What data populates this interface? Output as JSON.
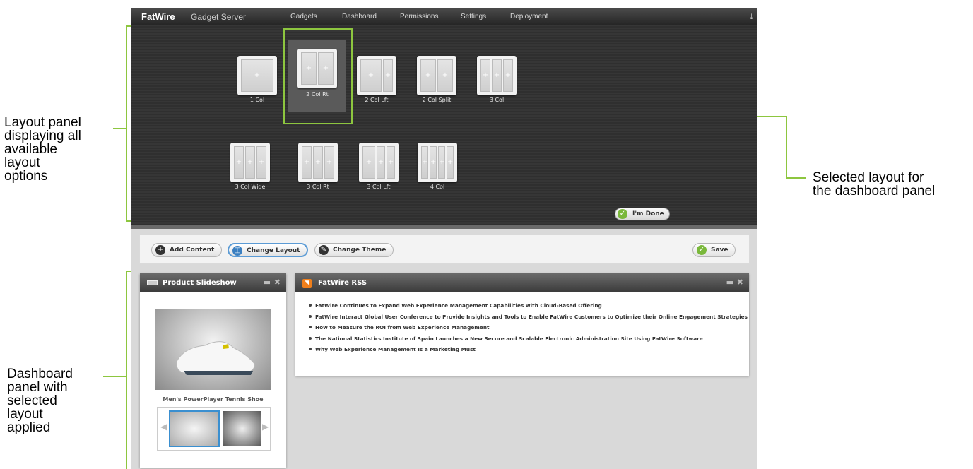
{
  "annotations": {
    "layout_panel": [
      "Layout panel",
      "displaying all",
      "available",
      "layout",
      "options"
    ],
    "selected_layout": [
      "Selected layout for",
      "the dashboard panel"
    ],
    "dashboard_panel": [
      "Dashboard",
      "panel with",
      "selected",
      "layout",
      "applied"
    ],
    "accent_color": "#8dc63f"
  },
  "topbar": {
    "brand": "FatWire",
    "product": "Gadget Server",
    "nav": [
      "Gadgets",
      "Dashboard",
      "Permissions",
      "Settings",
      "Deployment"
    ],
    "menu_icon": "menu-down-icon"
  },
  "layouts": {
    "row1": [
      {
        "label": "1 Col",
        "cols": 1
      },
      {
        "label": "2 Col Rt",
        "cols": 2,
        "selected": true
      },
      {
        "label": "2 Col Lft",
        "cols": 2
      },
      {
        "label": "2 Col Split",
        "cols": 2
      },
      {
        "label": "3 Col",
        "cols": 3
      }
    ],
    "row2": [
      {
        "label": "3 Col Wide",
        "cols": 3
      },
      {
        "label": "3 Col Rt",
        "cols": 3
      },
      {
        "label": "3 Col Lft",
        "cols": 3
      },
      {
        "label": "4 Col",
        "cols": 4
      }
    ],
    "done_label": "I'm Done"
  },
  "toolbar": {
    "add_content": "Add Content",
    "change_layout": "Change Layout",
    "change_theme": "Change Theme",
    "save": "Save"
  },
  "slideshow": {
    "title": "Product Slideshow",
    "caption": "Men's PowerPlayer Tennis Shoe"
  },
  "rss": {
    "title": "FatWire RSS",
    "items": [
      "FatWire Continues to Expand Web Experience Management Capabilities with Cloud-Based Offering",
      "FatWire Interact Global User Conference to Provide Insights and Tools to Enable FatWire Customers to Optimize their Online Engagement Strategies",
      "How to Measure the ROI from Web Experience Management",
      "The National Statistics Institute of Spain Launches a New Secure and Scalable Electronic Administration Site Using FatWire Software",
      "Why Web Experience Management Is a Marketing Must"
    ]
  }
}
